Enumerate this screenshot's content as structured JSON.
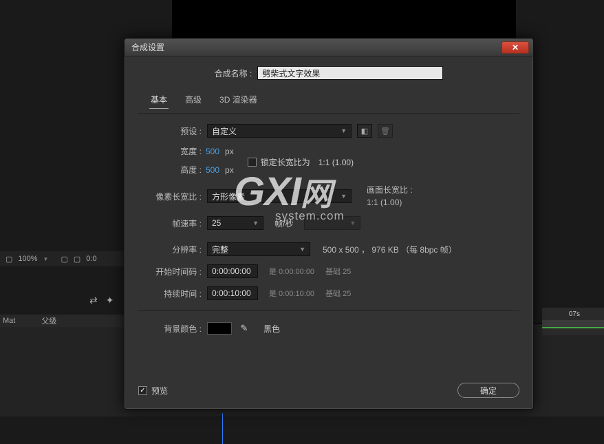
{
  "bg": {
    "zoom": "100%",
    "time_partial": "0:0",
    "time_marker": "07s",
    "track_mat": "Mat",
    "track_parent": "父级"
  },
  "dialog": {
    "title": "合成设置",
    "name_label": "合成名称 :",
    "name_value": "劈柴式文字效果",
    "tabs": {
      "basic": "基本",
      "advanced": "高级",
      "renderer": "3D 渲染器"
    },
    "preset": {
      "label": "预设",
      "value": "自定义"
    },
    "width": {
      "label": "宽度",
      "value": "500",
      "unit": "px"
    },
    "height": {
      "label": "高度",
      "value": "500",
      "unit": "px"
    },
    "lock_aspect": {
      "label": "锁定长宽比为",
      "ratio": "1:1 (1.00)",
      "checked": false
    },
    "pixel_aspect": {
      "label": "像素长宽比",
      "value": "方形像素"
    },
    "frame_aspect": {
      "label": "画面长宽比 :",
      "value": "1:1 (1.00)"
    },
    "framerate": {
      "label": "帧速率",
      "value": "25",
      "unit_label": "帧/秒"
    },
    "resolution": {
      "label": "分辨率",
      "value": "完整",
      "info": "500 x 500 ， 976 KB （每 8bpc 帧）"
    },
    "start_tc": {
      "label": "开始时间码",
      "value": "0:00:00:00",
      "hint_is": "是 0:00:00:00",
      "hint_base": "基础 25"
    },
    "duration": {
      "label": "持续时间",
      "value": "0:00:10:00",
      "hint_is": "是 0:00:10:00",
      "hint_base": "基础 25"
    },
    "bg_color": {
      "label": "背景颜色",
      "name": "黑色"
    },
    "preview": {
      "label": "预览",
      "checked": true
    },
    "ok": "确定"
  },
  "watermark": {
    "main": "GXI",
    "net": "网",
    "sub": "system.com"
  }
}
